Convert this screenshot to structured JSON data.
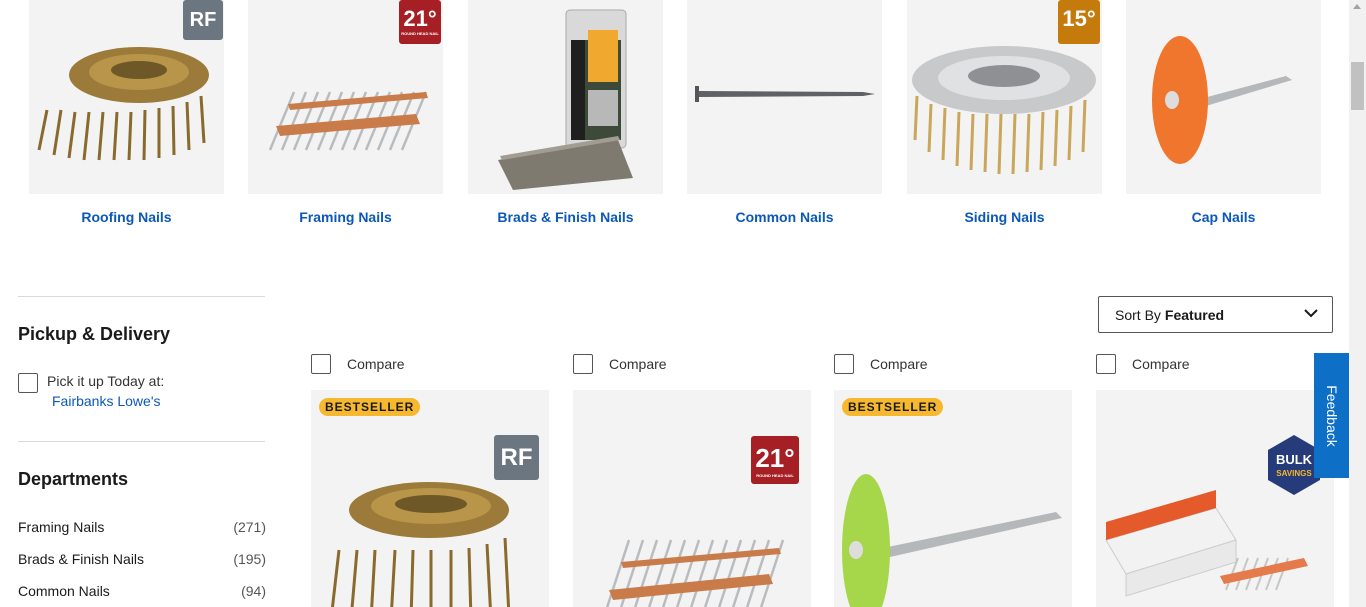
{
  "categories": [
    {
      "label": "Roofing Nails",
      "badge": "RF"
    },
    {
      "label": "Framing Nails",
      "badge": "21°"
    },
    {
      "label": "Brads & Finish Nails",
      "badge": ""
    },
    {
      "label": "Common Nails",
      "badge": ""
    },
    {
      "label": "Siding Nails",
      "badge": "15°"
    },
    {
      "label": "Cap Nails",
      "badge": ""
    }
  ],
  "sidebar": {
    "pickup_title": "Pickup & Delivery",
    "pickup_label": "Pick it up Today at:",
    "store_link": "Fairbanks Lowe's",
    "departments_title": "Departments",
    "departments": [
      {
        "label": "Framing Nails",
        "count": "(271)"
      },
      {
        "label": "Brads & Finish Nails",
        "count": "(195)"
      },
      {
        "label": "Common Nails",
        "count": "(94)"
      }
    ]
  },
  "sort": {
    "prefix": "Sort By",
    "value": "Featured"
  },
  "products": [
    {
      "compare_label": "Compare",
      "tag": "BESTSELLER",
      "badge": "RF"
    },
    {
      "compare_label": "Compare",
      "tag": "",
      "badge": "21°"
    },
    {
      "compare_label": "Compare",
      "tag": "BESTSELLER",
      "badge": ""
    },
    {
      "compare_label": "Compare",
      "tag": "",
      "badge": "BULK SAVINGS"
    }
  ],
  "feedback_label": "Feedback",
  "colors": {
    "link": "#0b58b8",
    "bestseller": "#f5b82e",
    "feedback": "#0e6fc6",
    "bulk_badge": "#263b7a"
  }
}
